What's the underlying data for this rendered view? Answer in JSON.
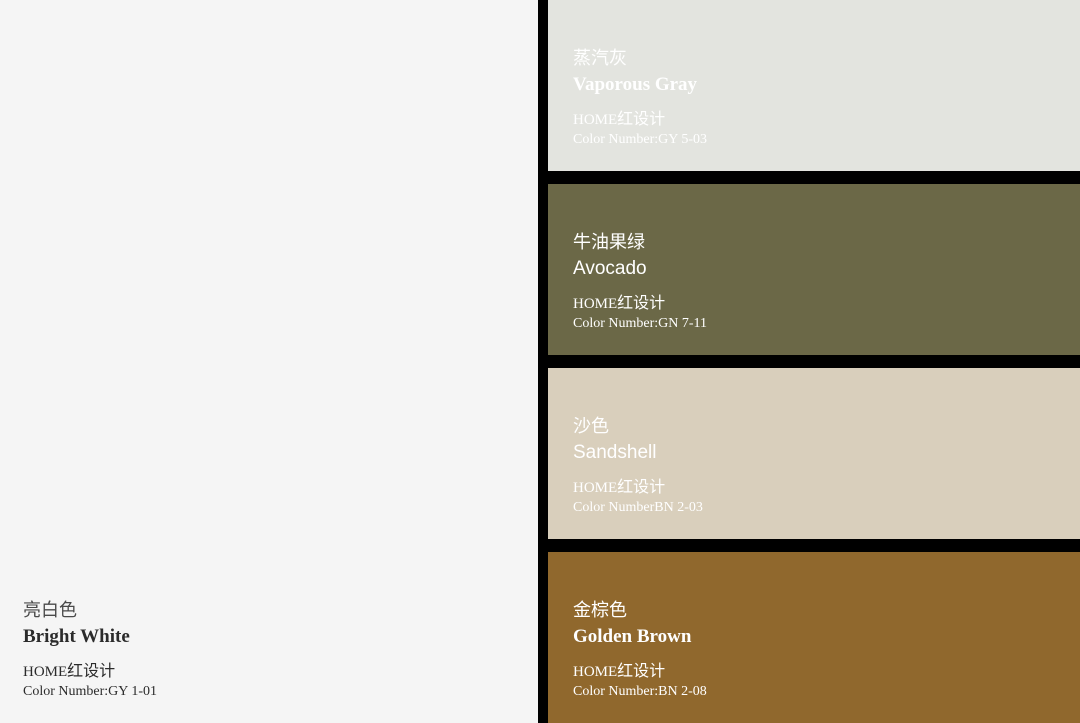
{
  "main": {
    "color": "#f5f5f5",
    "cn_name": "亮白色",
    "en_name": "Bright White",
    "brand_prefix": "HOME",
    "brand_cn": "红设计",
    "number": "Color Number:GY 1-01"
  },
  "swatches": [
    {
      "color": "#e3e4df",
      "cn_name": "蒸汽灰",
      "en_name": "Vaporous Gray",
      "brand_prefix": "HOME",
      "brand_cn": "红设计",
      "number": "Color Number:GY 5-03"
    },
    {
      "color": "#6b6847",
      "cn_name": "牛油果绿",
      "en_name": "Avocado",
      "brand_prefix": "HOME",
      "brand_cn": "红设计",
      "number": "Color Number:GN 7-11"
    },
    {
      "color": "#d9cfbc",
      "cn_name": "沙色",
      "en_name": "Sandshell",
      "brand_prefix": "HOME",
      "brand_cn": "红设计",
      "number": "Color NumberBN 2-03"
    },
    {
      "color": "#90682d",
      "cn_name": "金棕色",
      "en_name": "Golden Brown",
      "brand_prefix": "HOME",
      "brand_cn": "红设计",
      "number": "Color Number:BN 2-08"
    }
  ]
}
